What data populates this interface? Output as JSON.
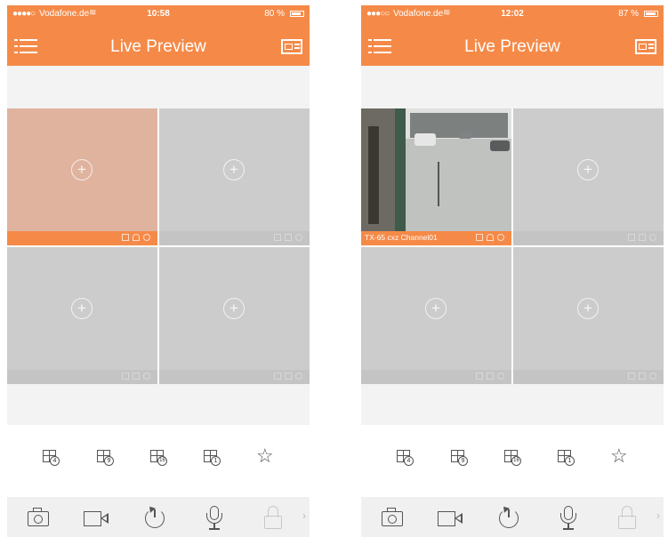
{
  "screens": [
    {
      "status": {
        "signal": "●●●●○",
        "carrier": "Vodafone.de",
        "wifi": "≋",
        "time": "10:58",
        "battery": "80 %"
      },
      "header": {
        "title": "Live Preview"
      },
      "cells": [
        {
          "selected": true,
          "channel_name": ""
        },
        {
          "selected": false,
          "channel_name": ""
        },
        {
          "selected": false,
          "channel_name": ""
        },
        {
          "selected": false,
          "channel_name": ""
        }
      ],
      "layout_buttons": [
        {
          "badge": "4"
        },
        {
          "badge": "9"
        },
        {
          "badge": "16"
        },
        {
          "badge": "1"
        }
      ],
      "toolbar": [
        "snapshot-icon",
        "record-icon",
        "playback-icon",
        "microphone-icon",
        "lock-icon"
      ]
    },
    {
      "status": {
        "signal": "●●●○○",
        "carrier": "Vodafone.de",
        "wifi": "≋",
        "time": "12:02",
        "battery": "87 %"
      },
      "header": {
        "title": "Live Preview"
      },
      "cells": [
        {
          "selected": true,
          "channel_name": "TX-65 cxz Channel01",
          "video": true
        },
        {
          "selected": false,
          "channel_name": ""
        },
        {
          "selected": false,
          "channel_name": ""
        },
        {
          "selected": false,
          "channel_name": ""
        }
      ],
      "layout_buttons": [
        {
          "badge": "4"
        },
        {
          "badge": "9"
        },
        {
          "badge": "16"
        },
        {
          "badge": "1"
        }
      ],
      "toolbar": [
        "snapshot-icon",
        "record-icon",
        "playback-icon",
        "microphone-icon",
        "lock-icon"
      ]
    }
  ],
  "colors": {
    "accent": "#f58a48",
    "selected_cell": "#e0b39f",
    "empty_cell": "#cccccc"
  }
}
